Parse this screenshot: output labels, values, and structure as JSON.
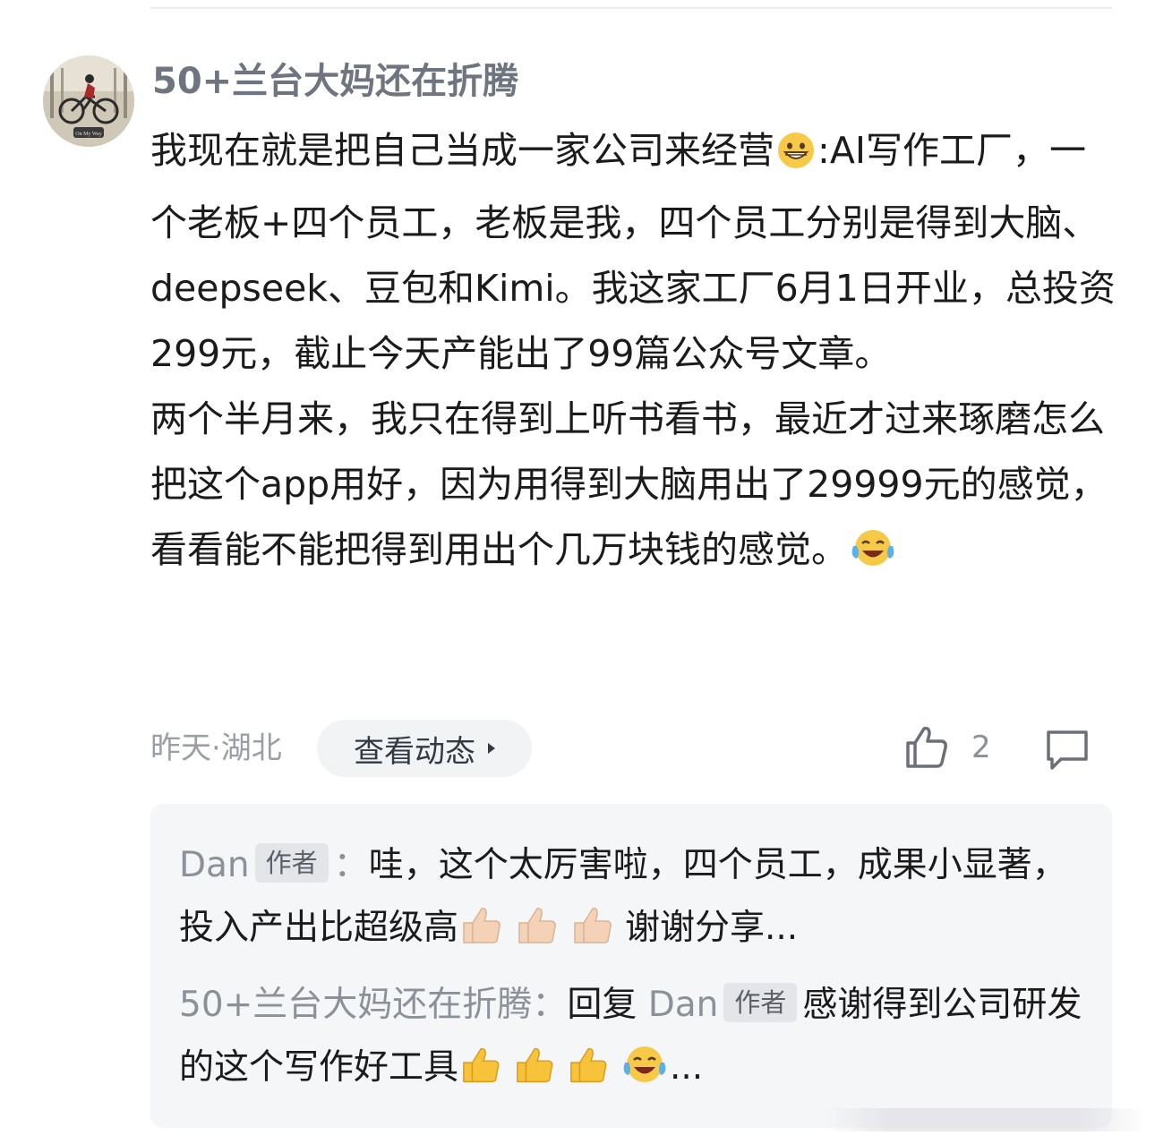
{
  "comment": {
    "username": "50+兰台大妈还在折腾",
    "content_lines": [
      "我现在就是把自己当成一家公司来经营",
      ":AI写作工厂，一个老板+四个员工，老板是我，四个员工分别是得到大脑、deepseek、豆包和Kimi。我这家工厂6月1日开业，总投资299元，截止今天产能出了99篇公众号文章。",
      "两个半月来，我只在得到上听书看书，最近才过来琢磨怎么把这个app用好，因为用得到大脑用出了29999元的感觉，看看能不能把得到用出个几万块钱的感觉。"
    ],
    "meta": "昨天·湖北",
    "view_dynamic_label": "查看动态",
    "like_count": "2"
  },
  "replies": [
    {
      "author": "Dan",
      "author_tag": "作者",
      "separator": "：",
      "text": "哇，这个太厉害啦，四个员工，成果小显著，投入产出比超级高",
      "suffix": "谢谢分享..."
    },
    {
      "author": "50+兰台大妈还在折腾",
      "separator": "：",
      "reply_word": "回复",
      "target": "Dan",
      "target_tag": "作者",
      "text": "感谢得到公司研发的这个写作好工具",
      "suffix": "..."
    }
  ],
  "icons": {
    "avatar": "cyclist-photo-avatar",
    "like": "thumbs-up-outline-icon",
    "reply": "comment-bubble-icon",
    "grin": "grinning-face-emoji",
    "laugh": "tears-of-joy-emoji",
    "thumb": "thumbs-up-emoji"
  },
  "colors": {
    "username": "#6e7480",
    "body_text": "#1b1b1b",
    "meta_text": "#9a9ea6",
    "reply_bg": "#f5f6f8"
  }
}
